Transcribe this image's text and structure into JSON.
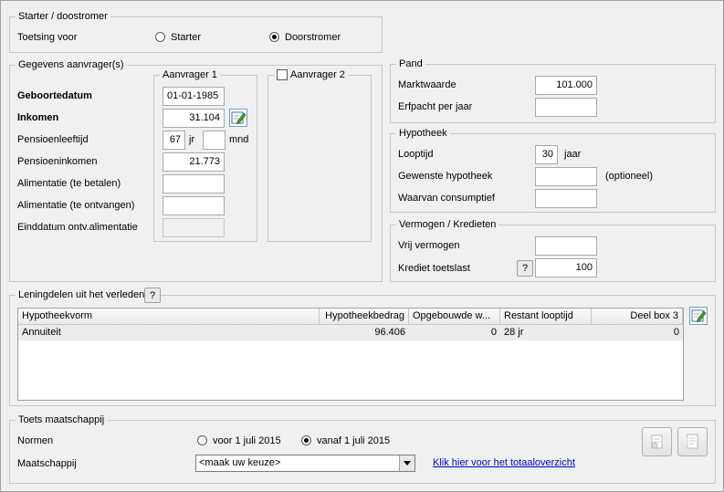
{
  "starter": {
    "legend": "Starter / doostromer",
    "toetsing_label": "Toetsing voor",
    "option_starter": "Starter",
    "option_doorstromer": "Doorstromer",
    "selected": "Doorstromer"
  },
  "aanvragers": {
    "legend": "Gegevens aanvrager(s)",
    "aanvrager1_legend": "Aanvrager 1",
    "aanvrager2_legend": "Aanvrager 2",
    "aanvrager2_checked": false,
    "geboortedatum_label": "Geboortedatum",
    "geboortedatum_value": "01-01-1985",
    "inkomen_label": "Inkomen",
    "inkomen_value": "31.104",
    "pensioenleeftijd_label": "Pensioenleeftijd",
    "pensioen_jr_value": "67",
    "jr_unit": "jr",
    "pensioen_mnd_value": "",
    "mnd_unit": "mnd",
    "pensioeninkomen_label": "Pensioeninkomen",
    "pensioeninkomen_value": "21.773",
    "alimentatie_betalen_label": "Alimentatie (te betalen)",
    "alimentatie_betalen_value": "",
    "alimentatie_ontvangen_label": "Alimentatie (te ontvangen)",
    "alimentatie_ontvangen_value": "",
    "einddatum_label": "Einddatum ontv.alimentatie",
    "einddatum_value": ""
  },
  "pand": {
    "legend": "Pand",
    "marktwaarde_label": "Marktwaarde",
    "marktwaarde_value": "101.000",
    "erfpacht_label": "Erfpacht per jaar",
    "erfpacht_value": ""
  },
  "hypotheek": {
    "legend": "Hypotheek",
    "looptijd_label": "Looptijd",
    "looptijd_value": "30",
    "looptijd_unit": "jaar",
    "gewenste_label": "Gewenste hypotheek",
    "gewenste_value": "",
    "optioneel": "(optioneel)",
    "consumptief_label": "Waarvan consumptief",
    "consumptief_value": ""
  },
  "vermogen": {
    "legend": "Vermogen / Kredieten",
    "vrij_label": "Vrij vermogen",
    "vrij_value": "",
    "krediet_label": "Krediet toetslast",
    "help": "?",
    "krediet_value": "100"
  },
  "leningdelen": {
    "legend": "Leningdelen uit het verleden",
    "help": "?",
    "columns": [
      "Hypotheekvorm",
      "Hypotheekbedrag",
      "Opgebouwde w...",
      "Restant looptijd",
      "Deel box 3"
    ],
    "rows": [
      [
        "Annuiteit",
        "96.406",
        "0",
        "28 jr",
        "0"
      ]
    ]
  },
  "toets": {
    "legend": "Toets maatschappij",
    "normen_label": "Normen",
    "option_voor": "voor 1 juli 2015",
    "option_vanaf": "vanaf 1 juli 2015",
    "selected": "vanaf 1 juli 2015",
    "maatschappij_label": "Maatschappij",
    "maatschappij_value": "<maak uw keuze>",
    "link": "Klik hier voor het totaaloverzicht"
  }
}
